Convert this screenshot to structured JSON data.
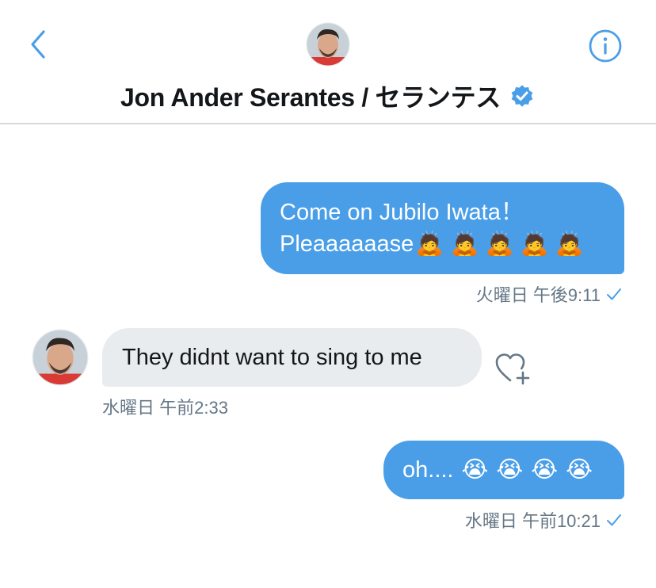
{
  "header": {
    "title": "Jon Ander Serantes / セランテス",
    "back_icon": "chevron-left-icon",
    "info_icon": "info-circle-icon",
    "verified_icon": "verified-badge-icon",
    "accent_color": "#4a9ee8"
  },
  "messages": [
    {
      "direction": "outgoing",
      "line1": "Come on Jubilo Iwata！",
      "line2": "Pleaaaaaase",
      "emoji": [
        "🙇",
        "🙇",
        "🙇",
        "🙇",
        "🙇"
      ],
      "timestamp": "火曜日 午後9:11"
    },
    {
      "direction": "incoming",
      "text": "They didnt want to sing to me",
      "timestamp": "水曜日 午前2:33"
    },
    {
      "direction": "outgoing",
      "text": "oh....",
      "emoji": [
        "😭",
        "😭",
        "😭",
        "😭"
      ],
      "timestamp": "水曜日 午前10:21"
    }
  ],
  "colors": {
    "outgoing_bubble": "#4a9ee8",
    "incoming_bubble": "#e9ecef",
    "timestamp": "#657786"
  }
}
